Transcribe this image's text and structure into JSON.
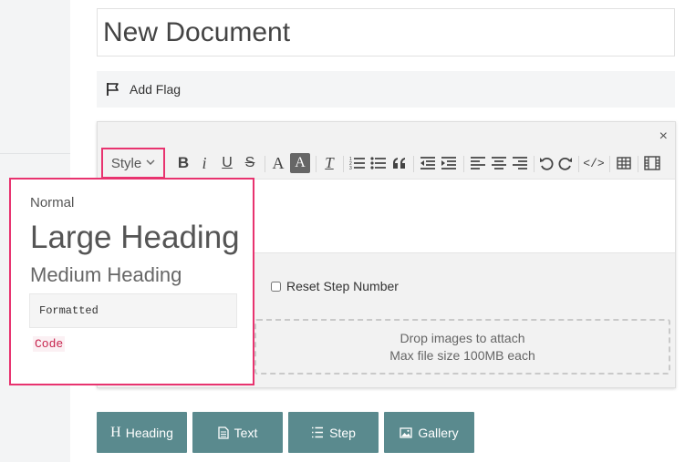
{
  "document": {
    "title_value": "New Document",
    "add_flag_label": "Add Flag",
    "close_glyph": "×"
  },
  "toolbar": {
    "style_label": "Style",
    "chevron": "⌄",
    "bold": "B",
    "italic": "i",
    "underline": "U",
    "strike": "S",
    "text_color": "A",
    "bg_color": "A",
    "clear_format": "T",
    "code_view": "</>",
    "icons": [
      "bold-icon",
      "italic-icon",
      "underline-icon",
      "strikethrough-icon",
      "font-color-icon",
      "background-color-icon",
      "clear-format-icon",
      "ordered-list-icon",
      "unordered-list-icon",
      "blockquote-icon",
      "outdent-icon",
      "indent-icon",
      "align-left-icon",
      "align-center-icon",
      "align-right-icon",
      "undo-icon",
      "redo-icon",
      "code-view-icon",
      "table-icon",
      "video-icon"
    ]
  },
  "editor": {
    "reset_step_label": "Reset Step Number",
    "drop_line1": "Drop images to attach",
    "drop_line2": "Max file size 100MB each"
  },
  "style_menu": {
    "normal": "Normal",
    "large_heading": "Large Heading",
    "medium_heading": "Medium Heading",
    "formatted": "Formatted",
    "code": "Code"
  },
  "bottom_buttons": {
    "heading": "Heading",
    "text": "Text",
    "step": "Step",
    "gallery": "Gallery"
  },
  "colors": {
    "highlight": "#e8336f",
    "button_teal": "#5a8a8e",
    "code_red": "#c7254e"
  }
}
